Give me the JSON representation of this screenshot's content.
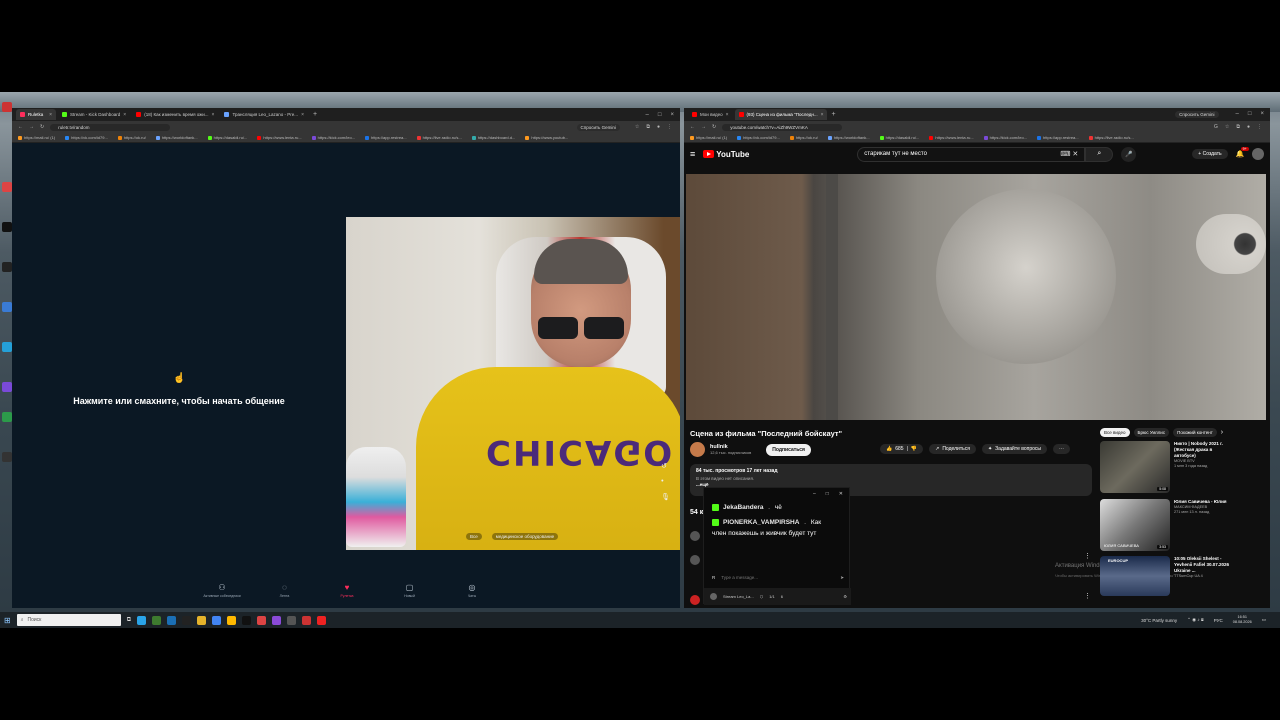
{
  "left_browser": {
    "tabs": [
      {
        "label": "Ruletka",
        "active": true
      },
      {
        "label": "Stream - Kick Dashboard",
        "active": false
      },
      {
        "label": "(18) Как изменить время ожи...",
        "active": false
      },
      {
        "label": "Трансляция Leo_Lazano - Pre...",
        "active": false
      }
    ],
    "gemini_label": "Спросить Gemini",
    "url": "ruletr.tv/random",
    "bookmarks": [
      "https://mail.ru/ (1)",
      "https://vk.com/id79...",
      "https://ok.ru/",
      "https://worldoftank...",
      "https://dasaldi.ru/...",
      "https://www.lenta.ru...",
      "https://kick.com/leo...",
      "https://app.restrea...",
      "https://live.radio.ru/s...",
      "https://dashboard.d...",
      "https://www.youtub..."
    ]
  },
  "ruletka": {
    "prompt_text": "Нажмите или смахните, чтобы начать общение",
    "cam_chip_all": "Все",
    "cam_chip_equipment": "медицинское оборудование",
    "nav": [
      {
        "icon": "people-icon",
        "label": "Активные собеседники"
      },
      {
        "icon": "chat-icon",
        "label": "Лента"
      },
      {
        "icon": "ruletka-icon",
        "label": "Рулетка",
        "active": true
      },
      {
        "icon": "lock-icon",
        "label": "Новый"
      },
      {
        "icon": "messages-icon",
        "label": "Чаты"
      }
    ]
  },
  "right_browser": {
    "tabs": [
      {
        "label": "Мои видео",
        "active": false
      },
      {
        "label": "(93) Сцена из фильма \"Последн...",
        "active": true
      }
    ],
    "gemini_label": "Спросить Gemini",
    "url": "youtube.com/watch?v=AiZh9WZVmKA",
    "bookmarks": [
      "https://mail.ru/ (1)",
      "https://vk.com/id79...",
      "https://ok.ru/",
      "https://worldoftank...",
      "https://dasaldi.ru/...",
      "https://www.lenta.ru...",
      "https://kick.com/leo...",
      "https://app.restrea...",
      "https://live.radio.ru/s..."
    ]
  },
  "youtube": {
    "logo": "YouTube",
    "search_value": "старикам тут не место",
    "create_label": "Создать",
    "notif_count": "9+",
    "video_title": "Сцена из фильма \"Последний бойскаут\"",
    "channel_name": "hullnik",
    "channel_subs": "12,6 тыс. подписчиков",
    "subscribe_label": "Подписаться",
    "likes": "685",
    "share_label": "Поделиться",
    "ask_label": "Задавайте вопросы",
    "desc_meta": "84 тыс. просмотров  17 лет назад",
    "desc_text": "В этом видео нет описания.",
    "desc_more": "...ещё",
    "comments_label": "54 комментария",
    "chips": [
      "Все видео",
      "Брюс Уиллис",
      "Похожий контент"
    ],
    "recommendations": [
      {
        "title": "Никто | Nobody 2021 г. (Жесткая драка в автобусе)",
        "channel": "MOVIE BTV",
        "meta": "1 млн  3 года назад",
        "duration": "5:08"
      },
      {
        "title": "Юлия Савичева - Юлия",
        "channel": "МАКСИМ ФАДЕЕВ",
        "meta": "271 млн  13 л. назад",
        "duration": "3:53",
        "thumb_text": "ЮЛИЯ САВИЧЕВА"
      },
      {
        "title": "10:05 Oleksii Shelest - Yevhenii Fafiel 30.07.2026 Ukraine ...",
        "channel": "TTSumCup UA 4",
        "meta": "",
        "duration": "",
        "thumb_text": "EUROCUP"
      }
    ],
    "watermark": "Активация Windows",
    "watermark_sub": "Чтобы активировать Windows, перейдите в раздел \"Параметры\"."
  },
  "chat_overlay": {
    "messages": [
      {
        "user": "JekaBandera",
        "text": "чё"
      },
      {
        "user": "PIONERKA_VAMPIRSHA",
        "text": "Как"
      }
    ],
    "continuation": "член покажешь и живчик будет тут",
    "input_placeholder": "Type a message...",
    "footer_name": "Stream Leo_La...",
    "footer_count1": "1/1",
    "footer_count2": "6"
  },
  "taskbar": {
    "search_placeholder": "Поиск",
    "weather": "30°C  Partly sunny",
    "lang": "РУС",
    "time": "16:51",
    "date": "08.08.2026"
  },
  "colors": {
    "kick_green": "#53fc18",
    "yt_red": "#ff0000",
    "ruletka_accent": "#ff2d5c"
  }
}
